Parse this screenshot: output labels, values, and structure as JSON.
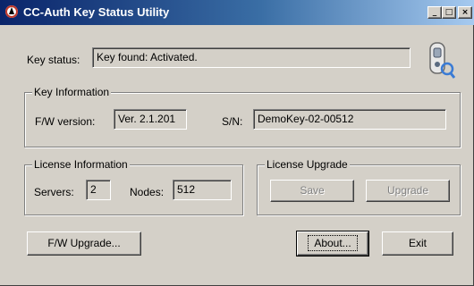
{
  "window": {
    "title": "CC-Auth Key Status Utility",
    "controls": {
      "minimize": "_",
      "maximize": "□",
      "close": "×"
    }
  },
  "key_status": {
    "label": "Key status:",
    "value": "Key found: Activated."
  },
  "key_information": {
    "legend": "Key Information",
    "fw_version_label": "F/W version:",
    "fw_version_value": "Ver. 2.1.201",
    "sn_label": "S/N:",
    "sn_value": "DemoKey-02-00512"
  },
  "license_information": {
    "legend": "License Information",
    "servers_label": "Servers:",
    "servers_value": "2",
    "nodes_label": "Nodes:",
    "nodes_value": "512"
  },
  "license_upgrade": {
    "legend": "License Upgrade",
    "save_label": "Save",
    "upgrade_label": "Upgrade"
  },
  "buttons": {
    "fw_upgrade": "F/W Upgrade...",
    "about": "About...",
    "exit": "Exit"
  },
  "icons": {
    "key": "usb-key-icon",
    "app": "app-icon"
  }
}
